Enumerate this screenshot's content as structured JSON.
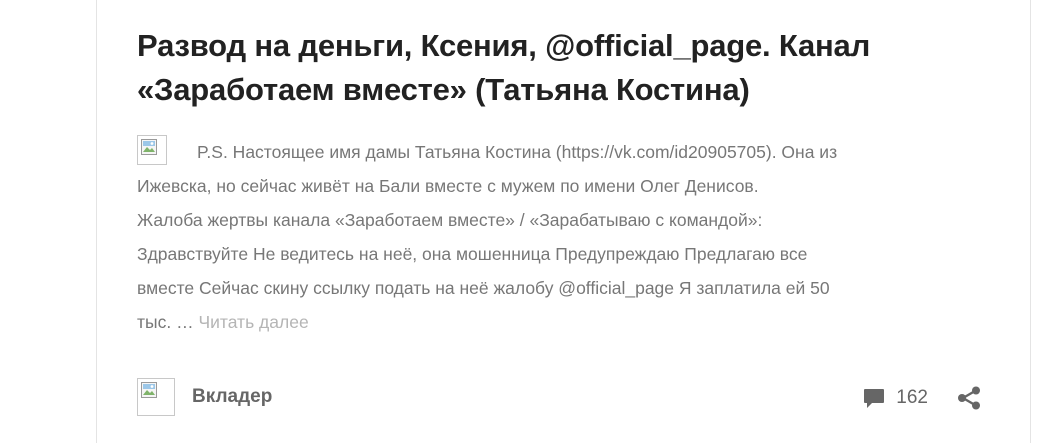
{
  "post": {
    "title": "Развод на деньги, Ксения, @official_page. Канал «Заработаем вместе» (Татьяна Костина)",
    "thumbnail_icon": "broken-image-icon",
    "excerpt": {
      "line1": "P.S. Настоящее имя дамы Татьяна Костина (https://vk.com/id20905705). Она из",
      "line2": "Ижевска, но сейчас живёт на Бали вместе с мужем по имени Олег Денисов.",
      "line3": "Жалоба жертвы канала «Заработаем вместе» / «Зарабатываю с командой»:",
      "line4": "Здравствуйте Не ведитесь на неё, она мошенница Предупреждаю Предлагаю все",
      "line5": "вместе Сейчас скину ссылку подать на неё жалобу @official_page Я заплатила ей 50",
      "line6": "тыс. …",
      "read_more": "Читать далее"
    },
    "author": {
      "name": "Вкладер",
      "avatar_icon": "broken-image-icon"
    },
    "comments": {
      "icon": "comment-bubble-icon",
      "count": "162"
    },
    "share_icon": "share-icon"
  },
  "colors": {
    "title": "#222222",
    "text": "#777777",
    "muted": "#b5b5b5",
    "icon": "#666666",
    "border": "#e4e4e4"
  }
}
